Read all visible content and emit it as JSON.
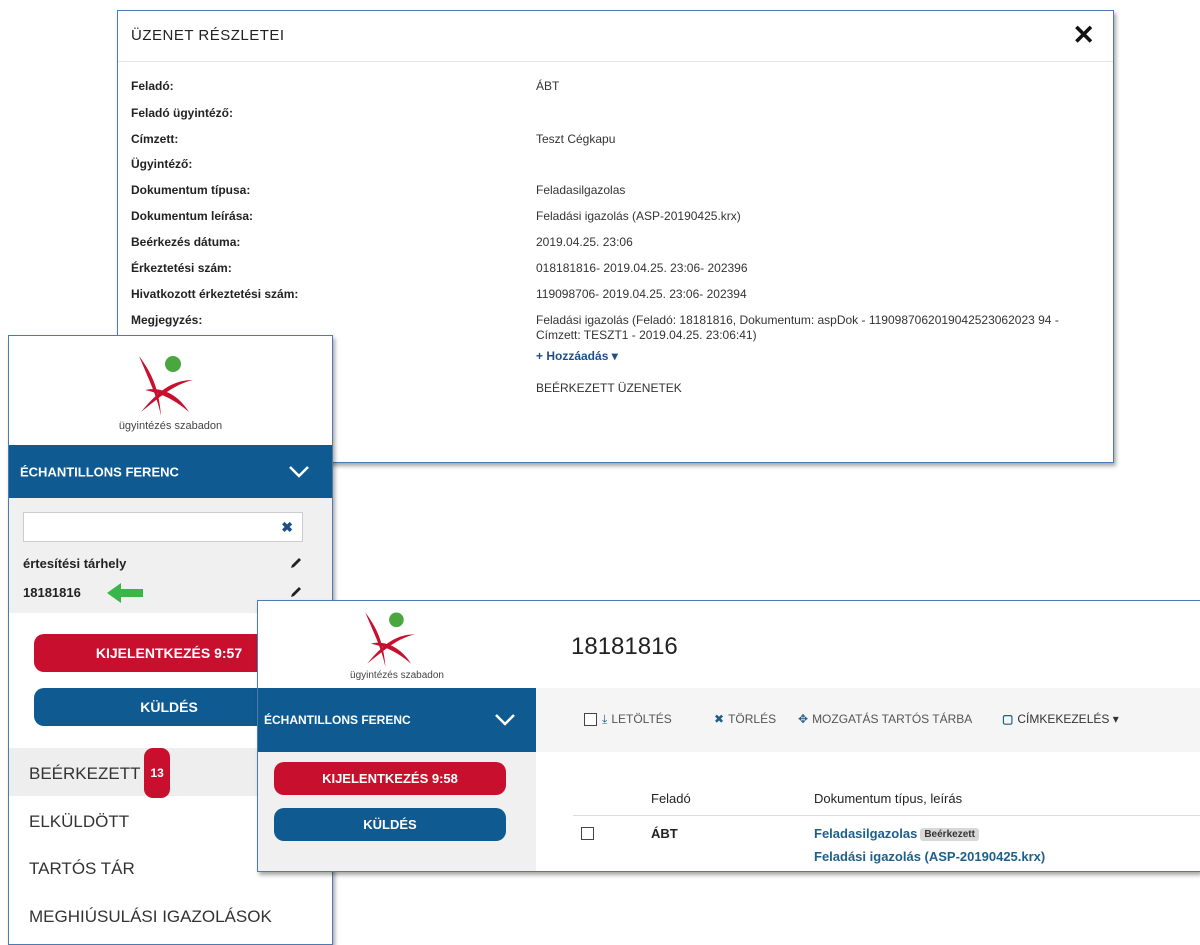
{
  "modal": {
    "title": "ÜZENET RÉSZLETEI",
    "close_glyph": "✕",
    "rows": [
      {
        "label": "Feladó:",
        "value": "ÁBT"
      },
      {
        "label": "Feladó ügyintéző:",
        "value": ""
      },
      {
        "label": "Címzett:",
        "value": "Teszt Cégkapu"
      },
      {
        "label": "Ügyintéző:",
        "value": ""
      },
      {
        "label": "Dokumentum típusa:",
        "value": "Feladasilgazolas"
      },
      {
        "label": "Dokumentum leírása:",
        "value": "Feladási igazolás (ASP-20190425.krx)"
      },
      {
        "label": "Beérkezés dátuma:",
        "value": "2019.04.25. 23:06"
      },
      {
        "label": "Érkeztetési szám:",
        "value": "018181816- 2019.04.25. 23:06- 202396"
      },
      {
        "label": "Hivatkozott érkeztetési szám:",
        "value": "119098706- 2019.04.25. 23:06- 202394"
      },
      {
        "label": "Megjegyzés:",
        "value": "Feladási igazolás (Feladó: 18181816, Dokumentum: aspDok - 1190987062019042523062023 94 - Címzett: TESZT1 - 2019.04.25. 23:06:41)"
      }
    ],
    "add_label": "+ Hozzáadás ▾",
    "folder_value": "BEÉRKEZETT ÜZENETEK"
  },
  "sidebar": {
    "logo_text": "ügyintézés szabadon",
    "user_name": "ÉCHANTILLONS FERENC",
    "search": {
      "value": "",
      "placeholder": ""
    },
    "storage_label": "értesítési tárhely",
    "storage_id": "18181816",
    "logout_label": "KIJELENTKEZÉS 9:57",
    "send_label": "KÜLDÉS",
    "nav": [
      {
        "label": "BEÉRKEZETT",
        "badge": "13"
      },
      {
        "label": "ELKÜLDÖTT"
      },
      {
        "label": "TARTÓS TÁR"
      },
      {
        "label": "MEGHIÚSULÁSI IGAZOLÁSOK"
      }
    ]
  },
  "main": {
    "logo_text": "ügyintézés szabadon",
    "user_name": "ÉCHANTILLONS FERENC",
    "logout_label": "KIJELENTKEZÉS 9:58",
    "send_label": "KÜLDÉS",
    "page_title": "18181816",
    "toolbar": {
      "download": "LETÖLTÉS",
      "delete": "TÖRLÉS",
      "move": "MOZGATÁS TARTÓS TÁRBA",
      "labels": "CÍMKEKEZELÉS ▾"
    },
    "table": {
      "headers": {
        "sender": "Feladó",
        "doc": "Dokumentum típus, leírás"
      },
      "rows": [
        {
          "sender": "ÁBT",
          "doc_type": "Feladasilgazolas",
          "status": "Beérkezett",
          "doc_desc": "Feladási igazolás (ASP-20190425.krx)"
        }
      ]
    }
  },
  "colors": {
    "brand_blue": "#0e5a91",
    "brand_red": "#c8102e",
    "logo_green": "#4aa63f",
    "arrow_green": "#39b54a"
  }
}
